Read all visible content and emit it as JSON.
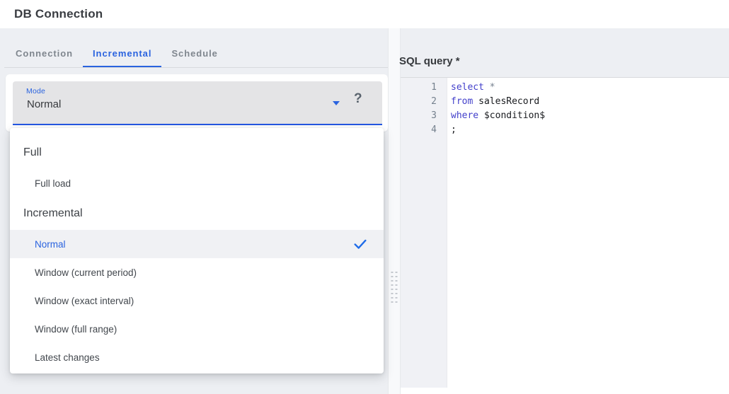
{
  "colors": {
    "accent_blue": "#2a63df",
    "select_underline_blue": "#2457e2",
    "page_bg": "#edeff3",
    "select_bg": "#e4e4e6",
    "selected_row_bg": "#f0f1f4",
    "check_blue": "#1e6be8",
    "code_keyword": "#4340cb",
    "code_operator": "#76808f",
    "code_text": "#191b1f",
    "line_number": "#74808d"
  },
  "header": {
    "title": "DB Connection"
  },
  "tabs": [
    {
      "label": "Connection",
      "active": false
    },
    {
      "label": "Incremental",
      "active": true
    },
    {
      "label": "Schedule",
      "active": false
    }
  ],
  "mode_select": {
    "label": "Mode",
    "value": "Normal",
    "help_glyph": "?"
  },
  "dropdown_menu": {
    "items": [
      {
        "type": "header",
        "label": "Full"
      },
      {
        "type": "option",
        "label": "Full load",
        "selected": false
      },
      {
        "type": "header",
        "label": "Incremental"
      },
      {
        "type": "option",
        "label": "Normal",
        "selected": true
      },
      {
        "type": "option",
        "label": "Window (current period)",
        "selected": false
      },
      {
        "type": "option",
        "label": "Window (exact interval)",
        "selected": false
      },
      {
        "type": "option",
        "label": "Window (full range)",
        "selected": false
      },
      {
        "type": "option",
        "label": "Latest changes",
        "selected": false
      }
    ]
  },
  "sql_editor": {
    "label": "SQL query *",
    "lines": [
      {
        "number": "1",
        "tokens": [
          {
            "text": "select",
            "type": "keyword"
          },
          {
            "text": " ",
            "type": "plain"
          },
          {
            "text": "*",
            "type": "operator"
          }
        ]
      },
      {
        "number": "2",
        "tokens": [
          {
            "text": "from",
            "type": "keyword"
          },
          {
            "text": " salesRecord",
            "type": "plain"
          }
        ]
      },
      {
        "number": "3",
        "tokens": [
          {
            "text": "where",
            "type": "keyword"
          },
          {
            "text": " $condition$",
            "type": "plain"
          }
        ]
      },
      {
        "number": "4",
        "tokens": [
          {
            "text": ";",
            "type": "plain"
          }
        ]
      }
    ]
  }
}
